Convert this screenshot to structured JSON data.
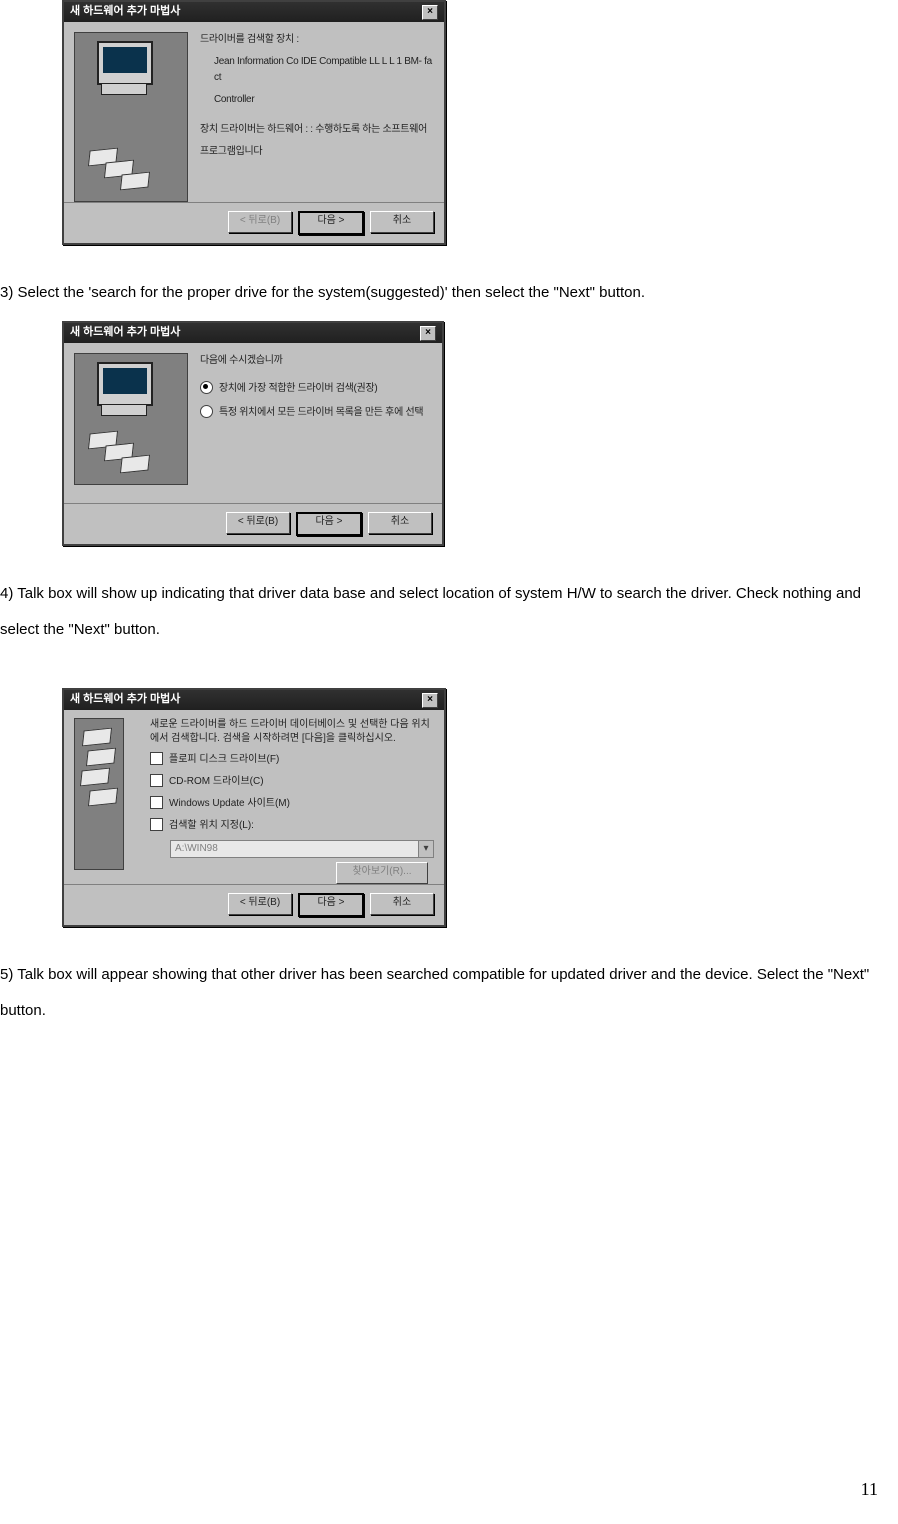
{
  "page_number": "11",
  "step3_text": "3) Select the 'search for the proper drive for the system(suggested)' then select the \"Next\" button.",
  "step4_text": "4) Talk box will show up indicating that driver data base and select location of system H/W to search the driver. Check nothing and select the \"Next\" button.",
  "step5_text": "5) Talk box will appear showing that other driver has been searched compatible for updated driver and the device. Select the \"Next\" button.",
  "dialog1": {
    "title": "새 하드웨어 추가 마법사",
    "heading": "드라이버를 검색할 장치 :",
    "device_line1": "Jean Information Co IDE Compatible LL L L 1 BM- fact",
    "device_line2": "Controller",
    "para1": "장치 드라이버는 하드웨어 : : 수행하도록 하는 소프트웨어",
    "para2": "프로그램입니다",
    "back": "< 뒤로(B)",
    "next": "다음 >",
    "cancel": "취소"
  },
  "dialog2": {
    "title": "새 하드웨어 추가 마법사",
    "prompt": "다음에 수시겠습니까",
    "opt1": "장치에 가장 적합한 드라이버 검색(권장)",
    "opt2": "특정 위치에서 모든 드라이버 목록을 만든 후에 선택",
    "back": "< 뒤로(B)",
    "next": "다음 >",
    "cancel": "취소"
  },
  "dialog3": {
    "title": "새 하드웨어 추가 마법사",
    "headtxt": "새로운 드라이버를 하드 드라이버 데이터베이스 및 선택한 다음 위치에서 검색합니다. 검색을 시작하려면 [다음]을 클릭하십시오.",
    "opt1": "플로피 디스크 드라이브(F)",
    "opt2": "CD-ROM 드라이브(C)",
    "opt3": "Windows Update 사이트(M)",
    "opt4": "검색할 위치 지정(L):",
    "field_text": "A:\\WIN98",
    "browse": "찾아보기(R)...",
    "back": "< 뒤로(B)",
    "next": "다음 >",
    "cancel": "취소"
  }
}
